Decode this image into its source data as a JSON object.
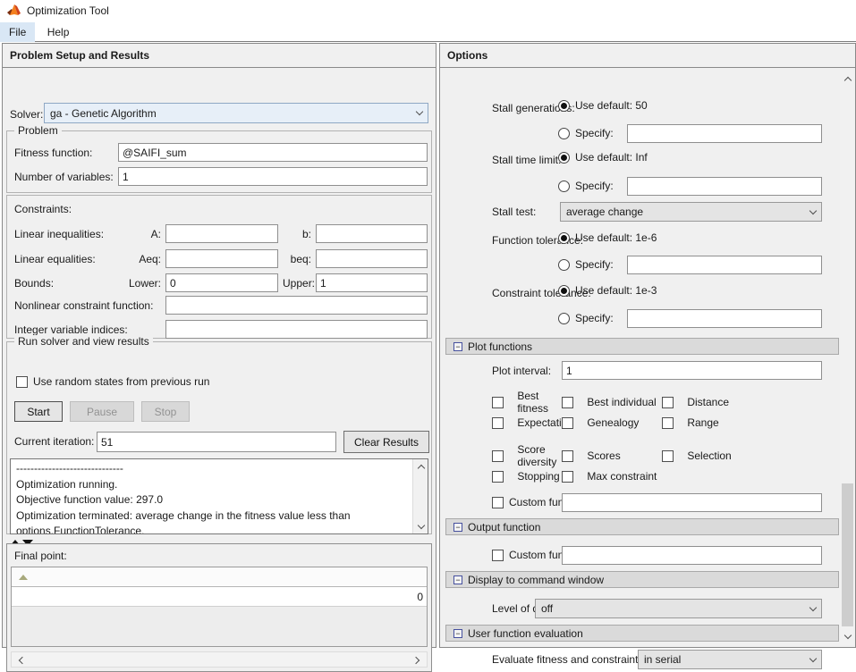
{
  "window_title": "Optimization Tool",
  "menu": {
    "file": "File",
    "help": "Help"
  },
  "colors": {
    "menu_highlight": "#d9e7f5",
    "solver_combo_bg": "#e7eff8",
    "panel_bg": "#f0f0f0"
  },
  "left": {
    "header": "Problem Setup and Results",
    "solver_label": "Solver:",
    "solver_value": "ga - Genetic Algorithm",
    "problem_legend": "Problem",
    "fitness_label": "Fitness function:",
    "fitness_value": "@SAIFI_sum",
    "nvars_label": "Number of variables:",
    "nvars_value": "1",
    "constraints_title": "Constraints:",
    "constraint_rows": [
      {
        "label": "Linear inequalities:",
        "k1": "A:",
        "v1": "",
        "k2": "b:",
        "v2": ""
      },
      {
        "label": "Linear equalities:",
        "k1": "Aeq:",
        "v1": "",
        "k2": "beq:",
        "v2": ""
      },
      {
        "label": "Bounds:",
        "k1": "Lower:",
        "v1": "0",
        "k2": "Upper:",
        "v2": "1"
      }
    ],
    "nonlinear_label": "Nonlinear constraint function:",
    "nonlinear_value": "",
    "integer_label": "Integer variable indices:",
    "integer_value": "",
    "run_legend": "Run solver and view results",
    "random_states": "Use random states from previous run",
    "btn_start": "Start",
    "btn_pause": "Pause",
    "btn_stop": "Stop",
    "iteration_label": "Current iteration:",
    "iteration_value": "51",
    "btn_clear": "Clear Results",
    "results": [
      "------------------------------",
      "Optimization running.",
      "Objective function value: 297.0",
      "Optimization terminated: average change in the fitness value less than",
      "options.FunctionTolerance."
    ],
    "final_point_label": "Final point:",
    "final_point_value": "0"
  },
  "right": {
    "header": "Options",
    "stall_generations_label": "Stall generations:",
    "stall_generations_default": "Use default: 50",
    "specify_label": "Specify:",
    "stall_time_label": "Stall time limit:",
    "stall_time_default": "Use default: Inf",
    "stall_test_label": "Stall test:",
    "stall_test_value": "average change",
    "func_tol_label": "Function tolerance:",
    "func_tol_default": "Use default: 1e-6",
    "con_tol_label": "Constraint tolerance:",
    "con_tol_default": "Use default: 1e-3",
    "plot_header": "Plot functions",
    "plot_interval_label": "Plot interval:",
    "plot_interval_value": "1",
    "plot_checks": [
      "Best fitness",
      "Best individual",
      "Distance",
      "Expectation",
      "Genealogy",
      "Range",
      "Score diversity",
      "Scores",
      "Selection",
      "Stopping",
      "Max constraint"
    ],
    "custom_function_label": "Custom function:",
    "output_header": "Output function",
    "display_header": "Display to command window",
    "display_label": "Level of display:",
    "display_value": "off",
    "eval_header": "User function evaluation",
    "eval_label": "Evaluate fitness and constraint functions:",
    "eval_value": "in serial"
  }
}
